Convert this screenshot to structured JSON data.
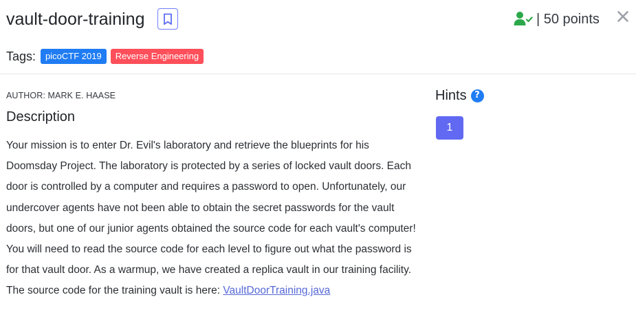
{
  "challenge": {
    "title": "vault-door-training",
    "points_text": "| 50 points",
    "solved": true
  },
  "tags": {
    "label": "Tags:",
    "items": [
      {
        "label": "picoCTF 2019",
        "color": "#1f7cf2"
      },
      {
        "label": "Reverse Engineering",
        "color": "#ff4f5b"
      }
    ]
  },
  "author": "AUTHOR: MARK E. HAASE",
  "description": {
    "heading": "Description",
    "text": "Your mission is to enter Dr. Evil's laboratory and retrieve the blueprints for his Doomsday Project. The laboratory is protected by a series of locked vault doors. Each door is controlled by a computer and requires a password to open. Unfortunately, our undercover agents have not been able to obtain the secret passwords for the vault doors, but one of our junior agents obtained the source code for each vault's computer! You will need to read the source code for each level to figure out what the password is for that vault door. As a warmup, we have created a replica vault in our training facility. The source code for the training vault is here: ",
    "link_text": "VaultDoorTraining.java"
  },
  "hints": {
    "heading": "Hints",
    "help_glyph": "?",
    "buttons": [
      "1"
    ]
  },
  "icons": {
    "bookmark": "bookmark-icon",
    "solved": "user-check-icon",
    "close": "close-icon",
    "help": "question-circle-icon"
  },
  "colors": {
    "primary": "#1f7cf2",
    "danger": "#ff4f5b",
    "success": "#28a745",
    "hint_button": "#6168f2",
    "link": "#5568d6"
  }
}
